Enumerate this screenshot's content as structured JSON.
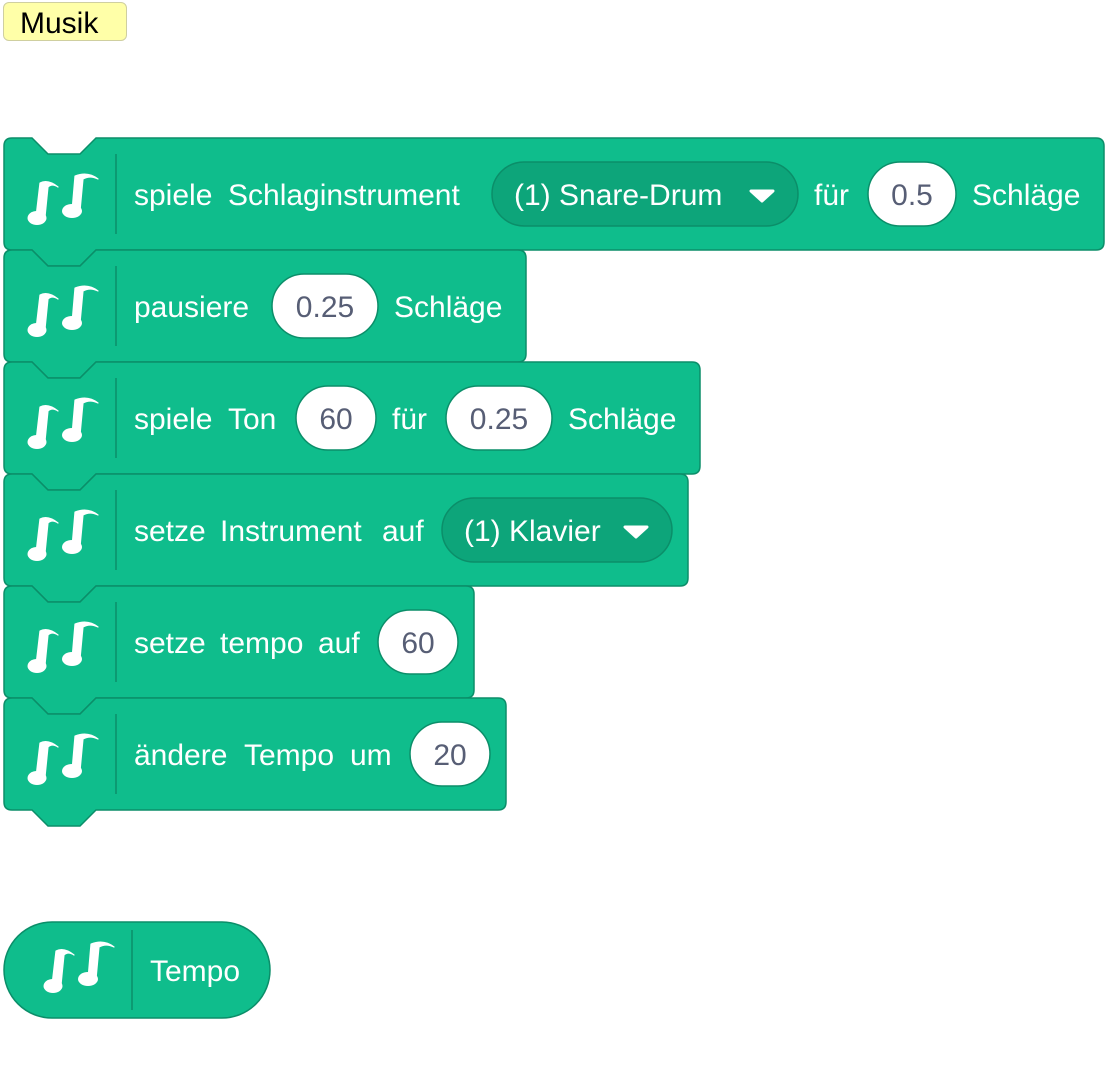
{
  "category": {
    "label": "Musik"
  },
  "colors": {
    "block": "#0fbd8c",
    "block_border": "#0b8e69",
    "dropdown": "#0da57a",
    "input_text": "#575e75"
  },
  "icon": "music-notes-icon",
  "blocks": [
    {
      "name": "play-drum-block",
      "parts": [
        {
          "type": "text",
          "text": "spiele"
        },
        {
          "type": "text",
          "text": "Schlaginstrument"
        },
        {
          "type": "dropdown",
          "text": "(1) Snare-Drum"
        },
        {
          "type": "text",
          "text": "für"
        },
        {
          "type": "input",
          "text": "0.5"
        },
        {
          "type": "text",
          "text": "Schläge"
        }
      ]
    },
    {
      "name": "rest-block",
      "parts": [
        {
          "type": "text",
          "text": "pausiere"
        },
        {
          "type": "input",
          "text": "0.25"
        },
        {
          "type": "text",
          "text": "Schläge"
        }
      ]
    },
    {
      "name": "play-note-block",
      "parts": [
        {
          "type": "text",
          "text": "spiele"
        },
        {
          "type": "text",
          "text": "Ton"
        },
        {
          "type": "input",
          "text": "60"
        },
        {
          "type": "text",
          "text": "für"
        },
        {
          "type": "input",
          "text": "0.25"
        },
        {
          "type": "text",
          "text": "Schläge"
        }
      ]
    },
    {
      "name": "set-instrument-block",
      "parts": [
        {
          "type": "text",
          "text": "setze"
        },
        {
          "type": "text",
          "text": "Instrument"
        },
        {
          "type": "text",
          "text": "auf"
        },
        {
          "type": "dropdown",
          "text": "(1) Klavier"
        }
      ]
    },
    {
      "name": "set-tempo-block",
      "parts": [
        {
          "type": "text",
          "text": "setze"
        },
        {
          "type": "text",
          "text": "tempo"
        },
        {
          "type": "text",
          "text": "auf"
        },
        {
          "type": "input",
          "text": "60"
        }
      ]
    },
    {
      "name": "change-tempo-block",
      "parts": [
        {
          "type": "text",
          "text": "ändere"
        },
        {
          "type": "text",
          "text": "Tempo"
        },
        {
          "type": "text",
          "text": "um"
        },
        {
          "type": "input",
          "text": "20"
        }
      ]
    }
  ],
  "reporter": {
    "label": "Tempo"
  }
}
